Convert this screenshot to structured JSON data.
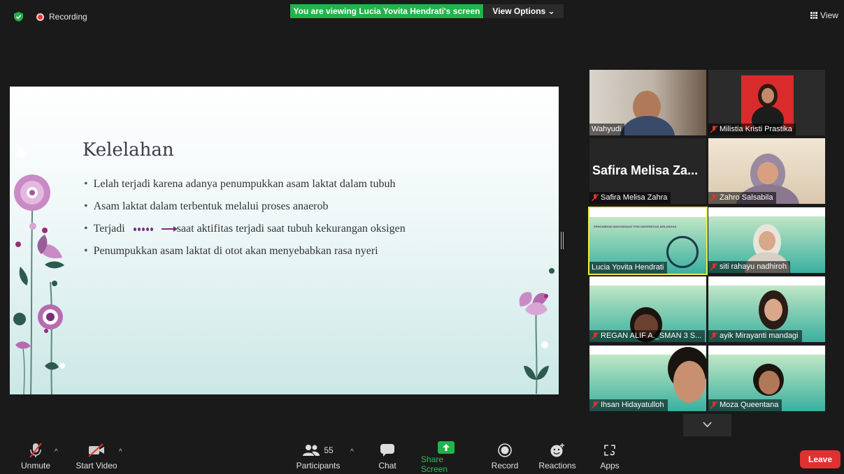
{
  "top_bar": {
    "recording_label": "Recording",
    "viewing_banner": "You are viewing Lucia Yovita Hendrati's screen",
    "view_options_label": "View Options ⌄",
    "view_label": "View"
  },
  "slide": {
    "title": "Kelelahan",
    "bullets": [
      "Lelah terjadi karena adanya penumpukkan asam laktat dalam tubuh",
      "Asam laktat dalam terbentuk melalui proses anaerob",
      "Terjadi",
      "Penumpukkan asam laktat di otot akan menyebabkan rasa nyeri"
    ],
    "bullet3_suffix": "saat aktifitas terjadi saat tubuh kekurangan oksigen"
  },
  "participants": [
    {
      "name": "Wahyudi",
      "muted": false
    },
    {
      "name": "Milistia Kristi Prastika",
      "muted": true
    },
    {
      "name": "Safira Melisa Zahra",
      "muted": true,
      "display_text": "Safira Melisa Za..."
    },
    {
      "name": "Zahro Salsabila",
      "muted": true
    },
    {
      "name": "Lucia Yovita Hendrati",
      "muted": false,
      "active_speaker": true
    },
    {
      "name": "siti rahayu nadhiroh",
      "muted": true
    },
    {
      "name": "REGAN ALIF A._SMAN 3 S...",
      "muted": true
    },
    {
      "name": "ayik Mirayanti mandagi",
      "muted": true
    },
    {
      "name": "Ihsan Hidayatulloh",
      "muted": true
    },
    {
      "name": "Moza Queentana",
      "muted": true
    }
  ],
  "tile_banner_text": "PENGABDIAN MASYARAKAT FKM UNIVERSITAS AIRLANGGA",
  "toolbar": {
    "unmute": "Unmute",
    "start_video": "Start Video",
    "participants": "Participants",
    "participants_count": "55",
    "chat": "Chat",
    "share_screen": "Share Screen",
    "record": "Record",
    "reactions": "Reactions",
    "apps": "Apps",
    "leave": "Leave"
  },
  "colors": {
    "share_green": "#22b34a",
    "leave_red": "#e0312f",
    "active_border": "#f0e94a",
    "accent_purple": "#7a2e7a"
  }
}
